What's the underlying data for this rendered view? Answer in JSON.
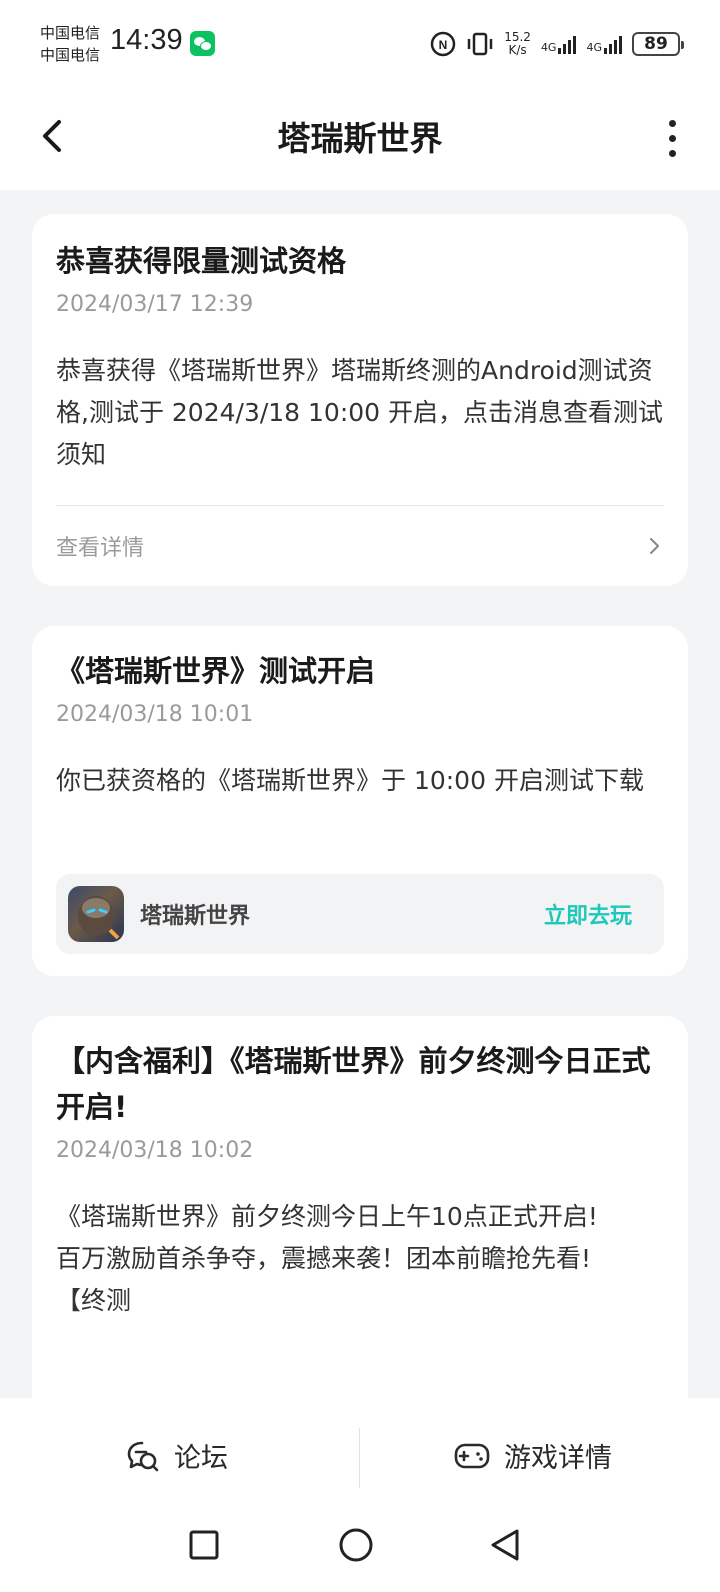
{
  "status_bar": {
    "carrier_1": "中国电信",
    "carrier_2": "中国电信",
    "time": "14:39",
    "speed_value": "15.2",
    "speed_unit": "K/s",
    "net_1": "4G",
    "net_2": "4G",
    "battery": "89"
  },
  "header": {
    "title": "塔瑞斯世界"
  },
  "cards": [
    {
      "title": "恭喜获得限量测试资格",
      "date": "2024/03/17 12:39",
      "body": "恭喜获得《塔瑞斯世界》塔瑞斯终测的Android测试资格,测试于 2024/3/18 10:00 开启，点击消息查看测试须知",
      "details_label": "查看详情"
    },
    {
      "title": "《塔瑞斯世界》测试开启",
      "date": "2024/03/18 10:01",
      "body": "你已获资格的《塔瑞斯世界》于 10:00 开启测试下载",
      "game_name": "塔瑞斯世界",
      "play_label": "立即去玩"
    },
    {
      "title": "【内含福利】《塔瑞斯世界》前夕终测今日正式开启!",
      "date": "2024/03/18 10:02",
      "body_lines": [
        "《塔瑞斯世界》前夕终测今日上午10点正式开启!",
        "百万激励首杀争夺，震撼来袭！团本前瞻抢先看!",
        "【终测"
      ]
    }
  ],
  "bottom_bar": {
    "forum_label": "论坛",
    "game_details_label": "游戏详情"
  },
  "colors": {
    "accent": "#1ec8b8",
    "background": "#f3f4f6",
    "card": "#ffffff",
    "muted_text": "#9a9a9a"
  },
  "icons": [
    "wechat-icon",
    "back-icon",
    "more-icon",
    "chevron-right-icon",
    "forum-icon",
    "gamepad-icon",
    "recent-apps-icon",
    "home-icon",
    "back-nav-icon"
  ]
}
